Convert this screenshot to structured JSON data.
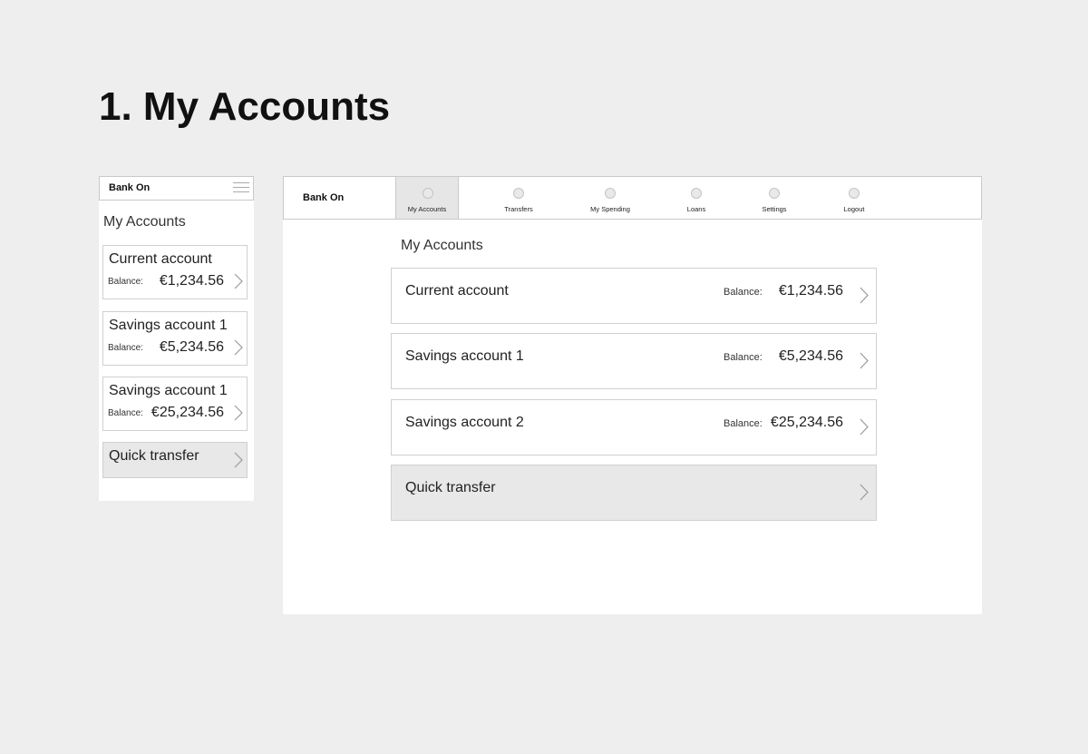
{
  "page": {
    "title": "1. My Accounts"
  },
  "mobile": {
    "brand": "Bank On",
    "section_title": "My Accounts",
    "accounts": [
      {
        "name": "Current account",
        "balance_label": "Balance:",
        "balance": "€1,234.56"
      },
      {
        "name": "Savings account 1",
        "balance_label": "Balance:",
        "balance": "€5,234.56"
      },
      {
        "name": "Savings account 1",
        "balance_label": "Balance:",
        "balance": "€25,234.56"
      }
    ],
    "quick_transfer": "Quick transfer"
  },
  "desktop": {
    "brand": "Bank On",
    "nav": [
      {
        "label": "My Accounts",
        "active": true
      },
      {
        "label": "Transfers",
        "active": false
      },
      {
        "label": "My Spending",
        "active": false
      },
      {
        "label": "Loans",
        "active": false
      },
      {
        "label": "Settings",
        "active": false
      },
      {
        "label": "Logout",
        "active": false
      }
    ],
    "section_title": "My Accounts",
    "accounts": [
      {
        "name": "Current account",
        "balance_label": "Balance:",
        "balance": "€1,234.56"
      },
      {
        "name": "Savings account 1",
        "balance_label": "Balance:",
        "balance": "€5,234.56"
      },
      {
        "name": "Savings account 2",
        "balance_label": "Balance:",
        "balance": "€25,234.56"
      }
    ],
    "quick_transfer": "Quick transfer"
  },
  "colors": {
    "background": "#eeeeee",
    "panel": "#ffffff",
    "border": "#c9c9c9",
    "active_nav": "#e6e6e6",
    "quick_transfer_bg": "#e8e8e8"
  },
  "icons": {
    "menu": "hamburger-menu-icon",
    "row_action": "chevron-right-icon",
    "nav": "circle-placeholder-icon"
  }
}
